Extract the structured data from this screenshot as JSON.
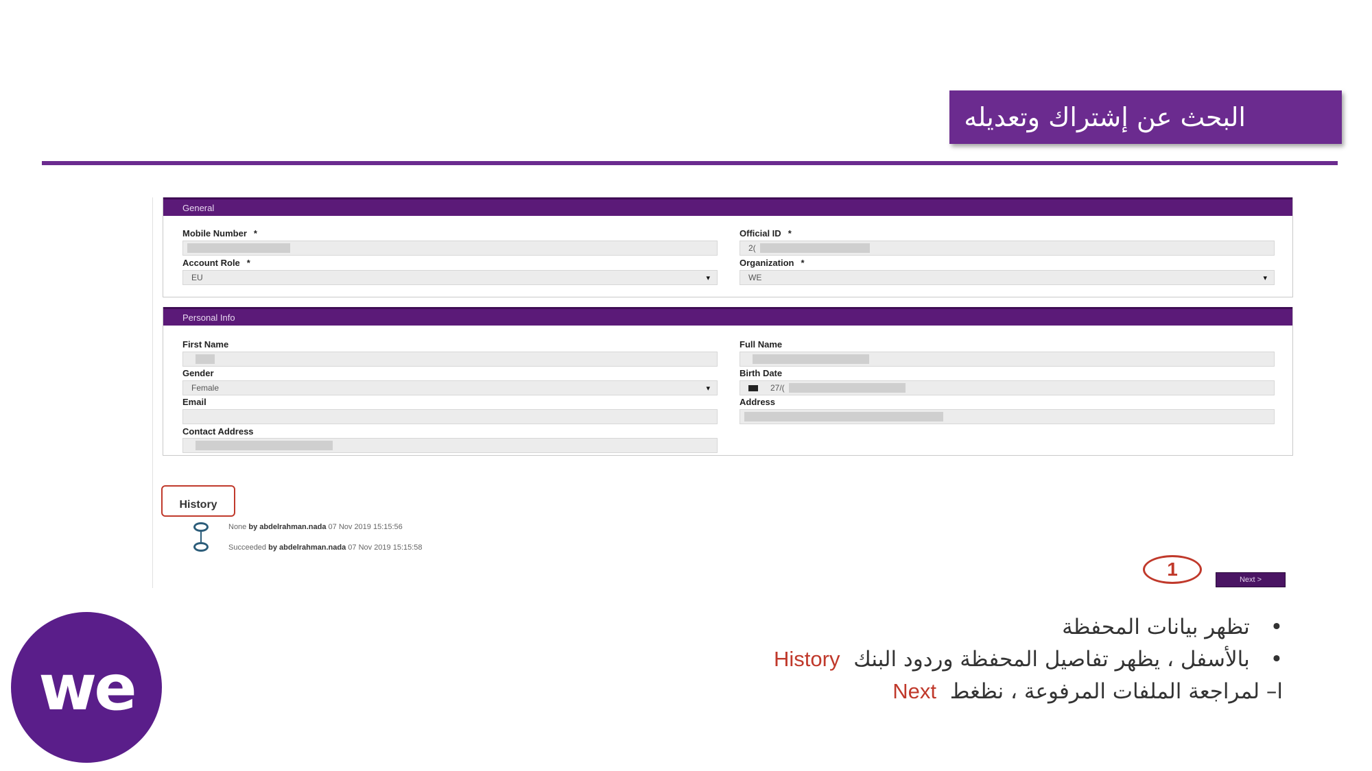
{
  "header": {
    "title": "البحث عن إشتراك وتعديله"
  },
  "general": {
    "section_title": "General",
    "mobile_number_label": "Mobile Number",
    "official_id_label": "Official ID",
    "official_id_value": "2(",
    "account_role_label": "Account Role",
    "account_role_value": "EU",
    "organization_label": "Organization",
    "organization_value": "WE",
    "required_mark": "*"
  },
  "personal": {
    "section_title": "Personal Info",
    "first_name_label": "First Name",
    "full_name_label": "Full Name",
    "gender_label": "Gender",
    "gender_value": "Female",
    "birth_date_label": "Birth Date",
    "birth_date_value": "27/(",
    "email_label": "Email",
    "address_label": "Address",
    "contact_address_label": "Contact Address"
  },
  "history": {
    "label": "History",
    "entries": [
      {
        "status": "None",
        "by": "by",
        "user": "abdelrahman.nada",
        "date": "07 Nov 2019 15:15:56"
      },
      {
        "status": "Succeeded",
        "by": "by",
        "user": "abdelrahman.nada",
        "date": "07 Nov 2019 15:15:58"
      }
    ]
  },
  "step": {
    "number": "1",
    "next_label": "Next  >"
  },
  "logo": {
    "text": "we"
  },
  "bullets": {
    "line1": "تظهر بيانات المحفظة",
    "line2_text": "بالأسفل ، يظهر تفاصيل المحفظة وردود البنك",
    "line2_highlight": "History",
    "line3_text": "ا– لمراجعة الملفات المرفوعة ، نظغط",
    "line3_highlight": "Next",
    "bullet_char": "•"
  },
  "colors": {
    "brand_purple": "#6b2b8f",
    "panel_header": "#5b1a78",
    "highlight_red": "#c0392b"
  }
}
